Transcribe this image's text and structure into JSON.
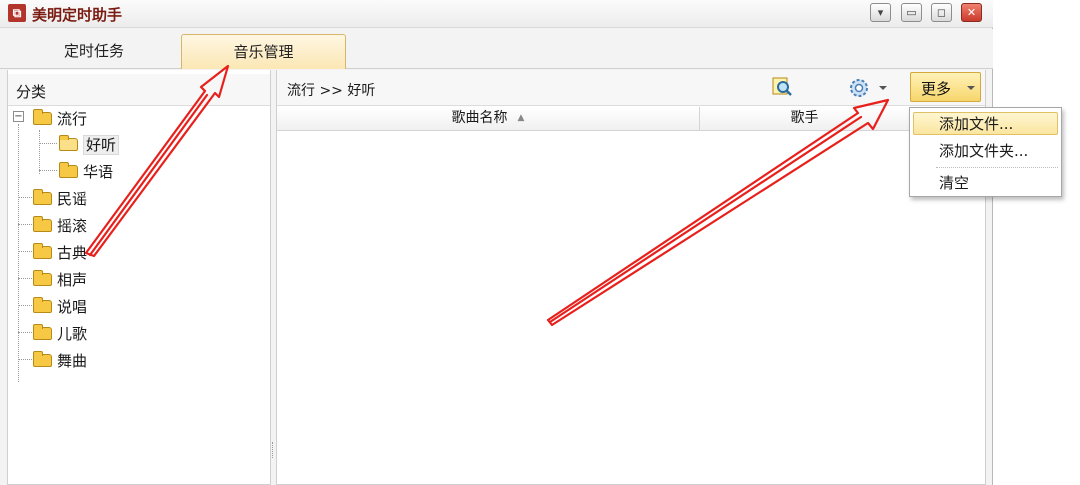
{
  "window": {
    "title": "美明定时助手",
    "icon": "app-logo-icon",
    "controls": [
      "dropdown-icon",
      "minimize-icon",
      "restore-icon",
      "close-icon"
    ]
  },
  "tabs": [
    {
      "label": "定时任务",
      "active": false
    },
    {
      "label": "音乐管理",
      "active": true
    }
  ],
  "sidebar": {
    "header": "分类",
    "tree": [
      {
        "label": "流行",
        "expanded": true,
        "children": [
          {
            "label": "好听",
            "selected": true
          },
          {
            "label": "华语"
          }
        ]
      },
      {
        "label": "民谣"
      },
      {
        "label": "摇滚"
      },
      {
        "label": "古典"
      },
      {
        "label": "相声"
      },
      {
        "label": "说唱"
      },
      {
        "label": "儿歌"
      },
      {
        "label": "舞曲"
      }
    ]
  },
  "toolbar": {
    "breadcrumb": "流行 >> 好听",
    "search_icon": "find-icon",
    "gear_icon": "gear-icon",
    "more_label": "更多"
  },
  "table": {
    "columns": [
      "歌曲名称",
      "歌手",
      ""
    ],
    "sorted_column": "歌曲名称",
    "rows": []
  },
  "more_menu": {
    "items": [
      "添加文件...",
      "添加文件夹...",
      "清空"
    ],
    "highlighted": "添加文件..."
  },
  "colors": {
    "accent": "#f7d56b",
    "title_text": "#7a1c12",
    "arrow": "#e8201c"
  }
}
